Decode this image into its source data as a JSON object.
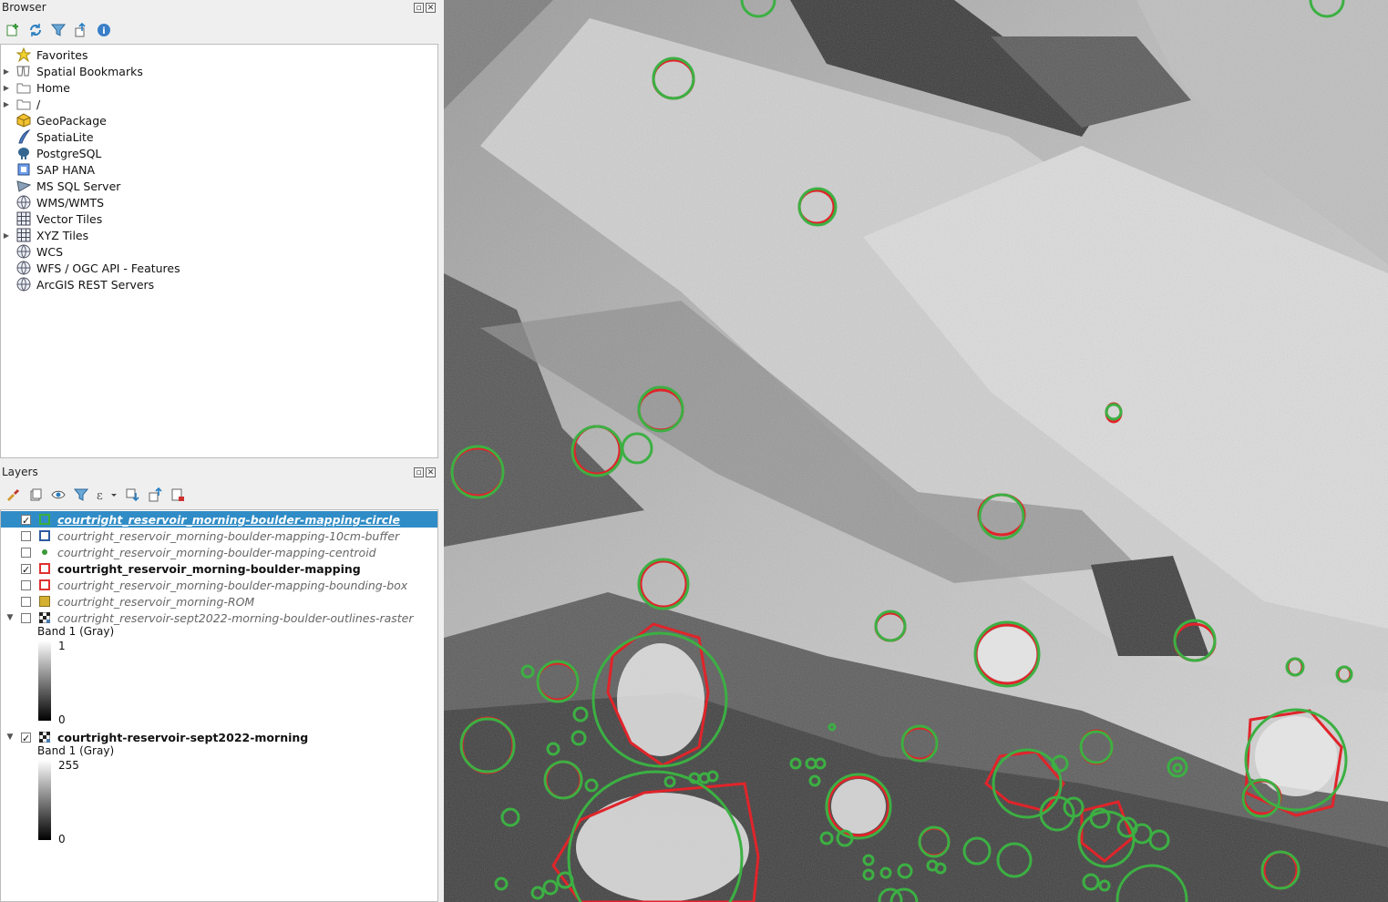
{
  "browser": {
    "title": "Browser",
    "toolbar": [
      "add-selected-layers-icon",
      "refresh-icon",
      "filter-icon",
      "collapse-all-icon",
      "properties-info-icon"
    ],
    "items": [
      {
        "label": "Favorites",
        "icon": "star-icon",
        "expandable": false
      },
      {
        "label": "Spatial Bookmarks",
        "icon": "bookmark-icon",
        "expandable": true
      },
      {
        "label": "Home",
        "icon": "folder-icon",
        "expandable": true
      },
      {
        "label": "/",
        "icon": "folder-icon",
        "expandable": true
      },
      {
        "label": "GeoPackage",
        "icon": "geopackage-icon",
        "expandable": false
      },
      {
        "label": "SpatiaLite",
        "icon": "spatialite-icon",
        "expandable": false
      },
      {
        "label": "PostgreSQL",
        "icon": "postgresql-icon",
        "expandable": false
      },
      {
        "label": "SAP HANA",
        "icon": "sap-hana-icon",
        "expandable": false
      },
      {
        "label": "MS SQL Server",
        "icon": "mssql-icon",
        "expandable": false
      },
      {
        "label": "WMS/WMTS",
        "icon": "globe-icon",
        "expandable": false
      },
      {
        "label": "Vector Tiles",
        "icon": "grid-icon",
        "expandable": false
      },
      {
        "label": "XYZ Tiles",
        "icon": "grid-icon",
        "expandable": true
      },
      {
        "label": "WCS",
        "icon": "globe-icon",
        "expandable": false
      },
      {
        "label": "WFS / OGC API - Features",
        "icon": "globe-icon",
        "expandable": false
      },
      {
        "label": "ArcGIS REST Servers",
        "icon": "globe-icon",
        "expandable": false
      }
    ]
  },
  "layers": {
    "title": "Layers",
    "toolbar": [
      "style-brush-icon",
      "add-group-icon",
      "visibility-eye-icon",
      "filter-legend-icon",
      "expression-filter-icon",
      "expand-all-icon",
      "collapse-all-icon",
      "remove-layer-icon"
    ],
    "items": [
      {
        "label": "courtright_reservoir_morning-boulder-mapping-circle",
        "checked": true,
        "selected": true,
        "swatch": "#3cae3c",
        "kind": "outline",
        "visible_style": "on"
      },
      {
        "label": "courtright_reservoir_morning-boulder-mapping-10cm-buffer",
        "checked": false,
        "selected": false,
        "swatch": "#2c5aa0",
        "kind": "outline",
        "visible_style": "off"
      },
      {
        "label": "courtright_reservoir_morning-boulder-mapping-centroid",
        "checked": false,
        "selected": false,
        "swatch": "#3a9a3a",
        "kind": "dot",
        "visible_style": "off"
      },
      {
        "label": "courtright_reservoir_morning-boulder-mapping",
        "checked": true,
        "selected": false,
        "swatch": "#e03030",
        "kind": "outline",
        "visible_style": "on"
      },
      {
        "label": "courtright_reservoir_morning-boulder-mapping-bounding-box",
        "checked": false,
        "selected": false,
        "swatch": "#e03030",
        "kind": "outline",
        "visible_style": "off"
      },
      {
        "label": "courtright_reservoir_morning-ROM",
        "checked": false,
        "selected": false,
        "swatch": "#d4b030",
        "kind": "fill",
        "visible_style": "off"
      }
    ],
    "rasters": [
      {
        "label": "courtright_reservoir-sept2022-morning-boulder-outlines-raster",
        "checked": false,
        "visible_style": "off",
        "band": "Band 1 (Gray)",
        "max": "1",
        "min": "0"
      },
      {
        "label": "courtright-reservoir-sept2022-morning",
        "checked": true,
        "visible_style": "on",
        "band": "Band 1 (Gray)",
        "max": "255",
        "min": "0"
      }
    ]
  },
  "colors": {
    "circle": "#3cb043",
    "polygon": "#e0242a",
    "selection": "#308cc6"
  }
}
